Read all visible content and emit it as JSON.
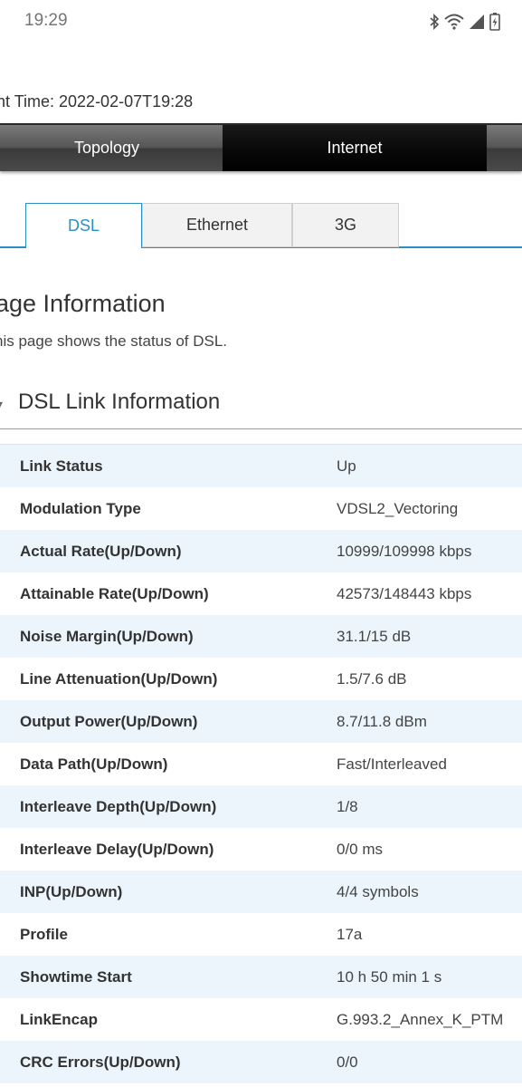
{
  "status_bar": {
    "time": "19:29",
    "icons": [
      "bluetooth-icon",
      "wifi-icon",
      "cellular-signal-icon",
      "battery-charging-icon"
    ]
  },
  "current_time_text": "nt Time: 2022-02-07T19:28",
  "nav": {
    "tabs": [
      {
        "label": "Topology",
        "active": false
      },
      {
        "label": "Internet",
        "active": true
      }
    ]
  },
  "sub_tabs": [
    {
      "label": "DSL",
      "active": true
    },
    {
      "label": "Ethernet",
      "active": false
    },
    {
      "label": "3G",
      "active": false
    }
  ],
  "page_heading": "age Information",
  "page_description": "his page shows the status of DSL.",
  "section_title": "DSL Link Information",
  "rows": [
    {
      "label": "Link Status",
      "value": "Up"
    },
    {
      "label": "Modulation Type",
      "value": "VDSL2_Vectoring"
    },
    {
      "label": "Actual Rate(Up/Down)",
      "value": "10999/109998 kbps"
    },
    {
      "label": "Attainable Rate(Up/Down)",
      "value": "42573/148443 kbps"
    },
    {
      "label": "Noise Margin(Up/Down)",
      "value": "31.1/15 dB"
    },
    {
      "label": "Line Attenuation(Up/Down)",
      "value": "1.5/7.6 dB"
    },
    {
      "label": "Output Power(Up/Down)",
      "value": "8.7/11.8 dBm"
    },
    {
      "label": "Data Path(Up/Down)",
      "value": "Fast/Interleaved"
    },
    {
      "label": "Interleave Depth(Up/Down)",
      "value": "1/8"
    },
    {
      "label": "Interleave Delay(Up/Down)",
      "value": "0/0 ms"
    },
    {
      "label": "INP(Up/Down)",
      "value": "4/4 symbols"
    },
    {
      "label": "Profile",
      "value": "17a"
    },
    {
      "label": "Showtime Start",
      "value": "10 h 50 min 1 s"
    },
    {
      "label": "LinkEncap",
      "value": "G.993.2_Annex_K_PTM"
    },
    {
      "label": "CRC Errors(Up/Down)",
      "value": "0/0"
    }
  ],
  "colors": {
    "accent": "#2b8fc4",
    "row_stripe": "#edf5fc"
  }
}
